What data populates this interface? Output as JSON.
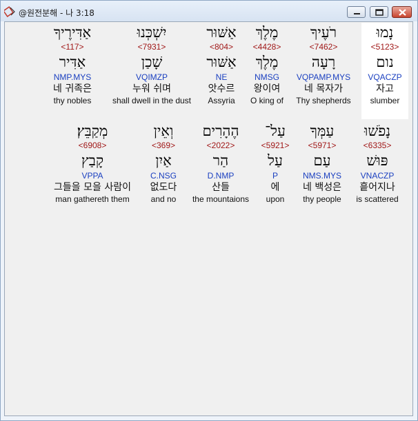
{
  "window": {
    "title": "@원전분해 - 나 3:18",
    "colors": {
      "strong_number": "#a01818",
      "parsing": "#1a3fc0",
      "text": "#111111"
    }
  },
  "rows": [
    {
      "words": [
        {
          "hebrew": "נָמוּ",
          "strong": "<5123>",
          "lemma": "נום",
          "parse": "VQACZP",
          "korean": "자고",
          "english": "slumber",
          "selected": true
        },
        {
          "hebrew": "רֹעֶיךָ",
          "strong": "<7462>",
          "lemma": "רָעָה",
          "parse": "VQPAMP.MYS",
          "korean": "네 목자가",
          "english": "Thy shepherds"
        },
        {
          "hebrew": "מֶלֶךְ",
          "strong": "<4428>",
          "lemma": "מֶלֶךְ",
          "parse": "NMSG",
          "korean": "왕이여",
          "english": "O king of"
        },
        {
          "hebrew": "אַשּׁוּר",
          "strong": "<804>",
          "lemma": "אַשּׁוּר",
          "parse": "NE",
          "korean": "앗수르",
          "english": "Assyria"
        },
        {
          "hebrew": "יִשְׁכְּנוּ",
          "strong": "<7931>",
          "lemma": "שָׁכַן",
          "parse": "VQIMZP",
          "korean": "누워 쉬며",
          "english": "shall dwell in the dust"
        },
        {
          "hebrew": "אַדִּירֶיךָ",
          "strong": "<117>",
          "lemma": "אַדִּיר",
          "parse": "NMP.MYS",
          "korean": "네 귀족은",
          "english": "thy nobles"
        }
      ]
    },
    {
      "words": [
        {
          "hebrew": "נָפֹשׁוּ",
          "strong": "<6335>",
          "lemma": "פּוּשׁ",
          "parse": "VNACZP",
          "korean": "흩어지나",
          "english": "is scattered"
        },
        {
          "hebrew": "עַמְּךָ",
          "strong": "<5971>",
          "lemma": "עַם",
          "parse": "NMS.MYS",
          "korean": "네 백성은",
          "english": "thy people"
        },
        {
          "hebrew": "עַל־",
          "strong": "<5921>",
          "lemma": "עַל",
          "parse": "P",
          "korean": "에",
          "english": "upon"
        },
        {
          "hebrew": "הֶהָרִים",
          "strong": "<2022>",
          "lemma": "הַר",
          "parse": "D.NMP",
          "korean": "산들",
          "english": "the mountaions"
        },
        {
          "hebrew": "וְאֵין",
          "strong": "<369>",
          "lemma": "אַיִן",
          "parse": "C.NSG",
          "korean": "없도다",
          "english": "and no"
        },
        {
          "hebrew": "מְקַבֵּץ׃",
          "strong": "<6908>",
          "lemma": "קָבַץ",
          "parse": "VPPA",
          "korean": "그들을 모을 사람이",
          "english": "man gathereth them"
        }
      ]
    }
  ]
}
